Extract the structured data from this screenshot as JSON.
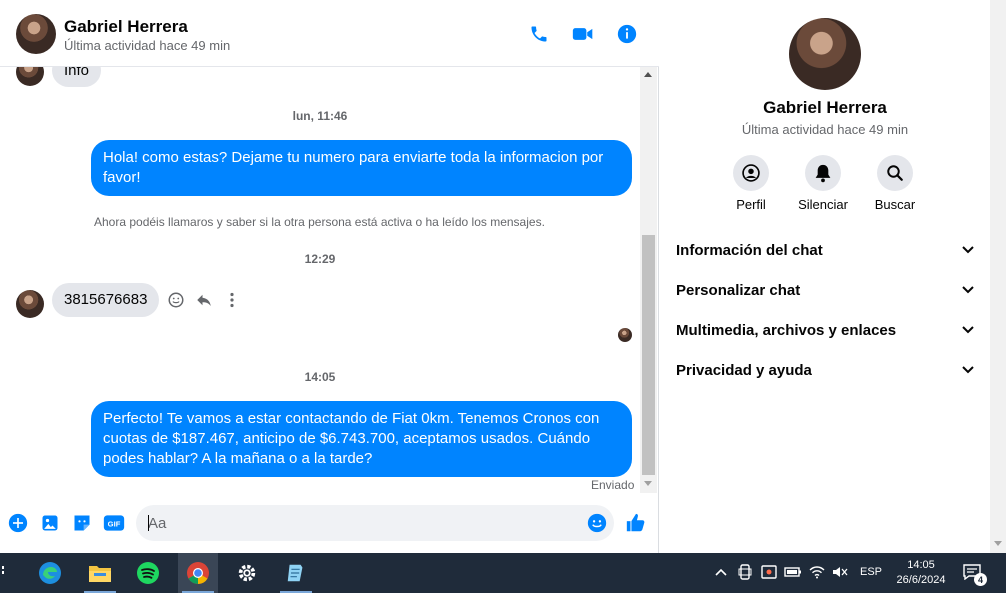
{
  "contact": {
    "name": "Gabriel Herrera",
    "status": "Última actividad hace 49 min"
  },
  "header": {
    "icons": [
      "phone-icon",
      "video-icon",
      "info-icon"
    ]
  },
  "messages": {
    "top_partial": "Info",
    "ts1": "lun, 11:46",
    "out1": "Hola! como estas? Dejame tu numero para enviarte toda la informacion por favor!",
    "system_note": "Ahora podéis llamaros y saber si la otra persona está activa o ha leído los mensajes.",
    "ts2": "12:29",
    "in1": "3815676683",
    "ts3": "14:05",
    "out2": "Perfecto! Te vamos a estar contactando de Fiat 0km. Tenemos Cronos con cuotas de $187.467, anticipo de $6.743.700, aceptamos usados. Cuándo podes hablar? A la mañana o a la tarde?",
    "sent_label": "Enviado"
  },
  "composer": {
    "placeholder": "Aa",
    "gif_label": "GIF"
  },
  "panel": {
    "actions": [
      {
        "label": "Perfil",
        "icon": "profile-icon"
      },
      {
        "label": "Silenciar",
        "icon": "bell-icon"
      },
      {
        "label": "Buscar",
        "icon": "search-icon"
      }
    ],
    "sections": [
      "Información del chat",
      "Personalizar chat",
      "Multimedia, archivos y enlaces",
      "Privacidad y ayuda"
    ]
  },
  "taskbar": {
    "lang": "ESP",
    "time": "14:05",
    "date": "26/6/2024",
    "notifications": "4"
  },
  "colors": {
    "accent": "#0084ff",
    "bubble_in": "#e4e6eb",
    "taskbar": "#1f2b3a"
  }
}
